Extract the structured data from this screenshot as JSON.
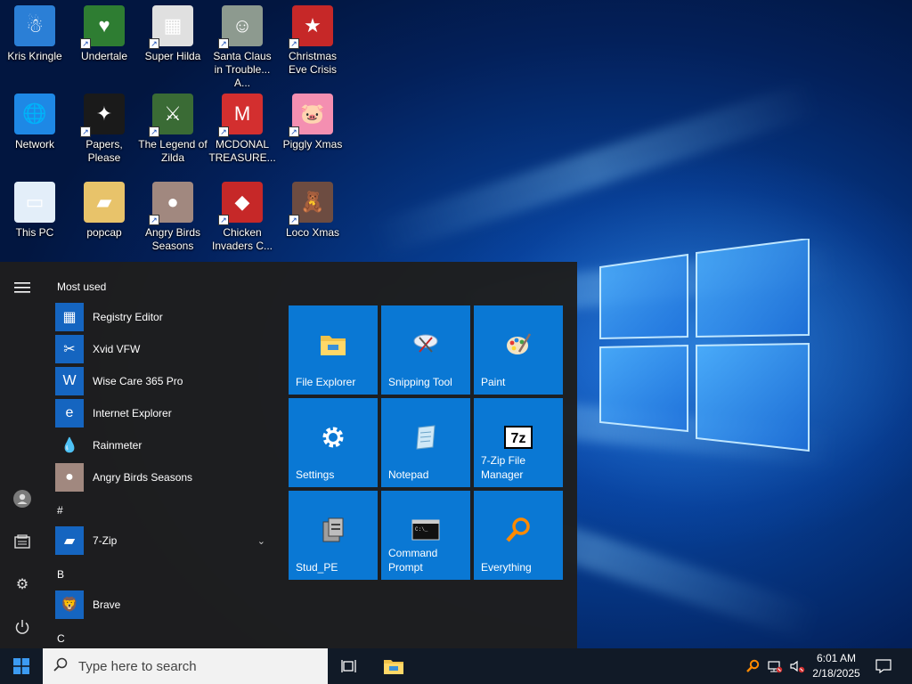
{
  "desktop": {
    "icons": [
      {
        "label": "Kris Kringle",
        "icon": "kris-kringle-icon",
        "color": "#2b7fd6"
      },
      {
        "label": "Undertale",
        "icon": "undertale-icon",
        "color": "#2e7d32"
      },
      {
        "label": "Super Hilda",
        "icon": "super-hilda-icon",
        "color": "#e0e0e0"
      },
      {
        "label": "Santa Claus in Trouble... A...",
        "icon": "santa-claus-icon",
        "color": "#8d9a8f"
      },
      {
        "label": "Christmas Eve Crisis",
        "icon": "christmas-eve-icon",
        "color": "#c62828"
      },
      {
        "label": "Network",
        "icon": "network-icon",
        "color": "#1e88e5"
      },
      {
        "label": "Papers, Please",
        "icon": "papers-please-icon",
        "color": "#1a1a1a"
      },
      {
        "label": "The Legend of Zilda",
        "icon": "legend-of-zilda-icon",
        "color": "#3a6b35"
      },
      {
        "label": "MCDONAL TREASURE...",
        "icon": "mcdonald-icon",
        "color": "#d32f2f"
      },
      {
        "label": "Piggly Xmas",
        "icon": "piggly-icon",
        "color": "#f48fb1"
      },
      {
        "label": "This PC",
        "icon": "this-pc-icon",
        "color": "#e3eef9"
      },
      {
        "label": "popcap",
        "icon": "folder-icon",
        "color": "#e8c36a"
      },
      {
        "label": "Angry Birds Seasons",
        "icon": "angry-birds-icon",
        "color": "#a1887f"
      },
      {
        "label": "Chicken Invaders C...",
        "icon": "chicken-invaders-icon",
        "color": "#c62828"
      },
      {
        "label": "Loco Xmas",
        "icon": "loco-xmas-icon",
        "color": "#6d4c41"
      }
    ]
  },
  "start_menu": {
    "most_used_label": "Most used",
    "most_used": [
      {
        "label": "Registry Editor",
        "icon": "registry-icon",
        "color": "#1565c0"
      },
      {
        "label": "Xvid VFW",
        "icon": "xvid-icon",
        "color": "#1565c0"
      },
      {
        "label": "Wise Care 365 Pro",
        "icon": "wise-care-icon",
        "color": "#1565c0"
      },
      {
        "label": "Internet Explorer",
        "icon": "internet-explorer-icon",
        "color": "#1565c0"
      },
      {
        "label": "Rainmeter",
        "icon": "rainmeter-icon",
        "color": "transparent"
      },
      {
        "label": "Angry Birds Seasons",
        "icon": "angry-birds-icon",
        "color": "#a1887f"
      }
    ],
    "groups": [
      {
        "letter": "#",
        "items": [
          {
            "label": "7-Zip",
            "icon": "folder-icon",
            "color": "#1565c0",
            "expandable": true
          }
        ]
      },
      {
        "letter": "B",
        "items": [
          {
            "label": "Brave",
            "icon": "brave-icon",
            "color": "#1565c0"
          }
        ]
      },
      {
        "letter": "C",
        "items": []
      }
    ],
    "tiles": [
      {
        "label": "File Explorer",
        "icon": "file-explorer-icon"
      },
      {
        "label": "Snipping Tool",
        "icon": "snipping-tool-icon"
      },
      {
        "label": "Paint",
        "icon": "paint-icon"
      },
      {
        "label": "Settings",
        "icon": "settings-icon"
      },
      {
        "label": "Notepad",
        "icon": "notepad-icon"
      },
      {
        "label": "7-Zip File Manager",
        "icon": "sevenzip-icon"
      },
      {
        "label": "Stud_PE",
        "icon": "stud-pe-icon"
      },
      {
        "label": "Command Prompt",
        "icon": "command-prompt-icon"
      },
      {
        "label": "Everything",
        "icon": "everything-icon"
      }
    ],
    "tile_color": "#0a78d4"
  },
  "taskbar": {
    "search_placeholder": "Type here to search",
    "clock_time": "6:01 AM",
    "clock_date": "2/18/2025"
  }
}
